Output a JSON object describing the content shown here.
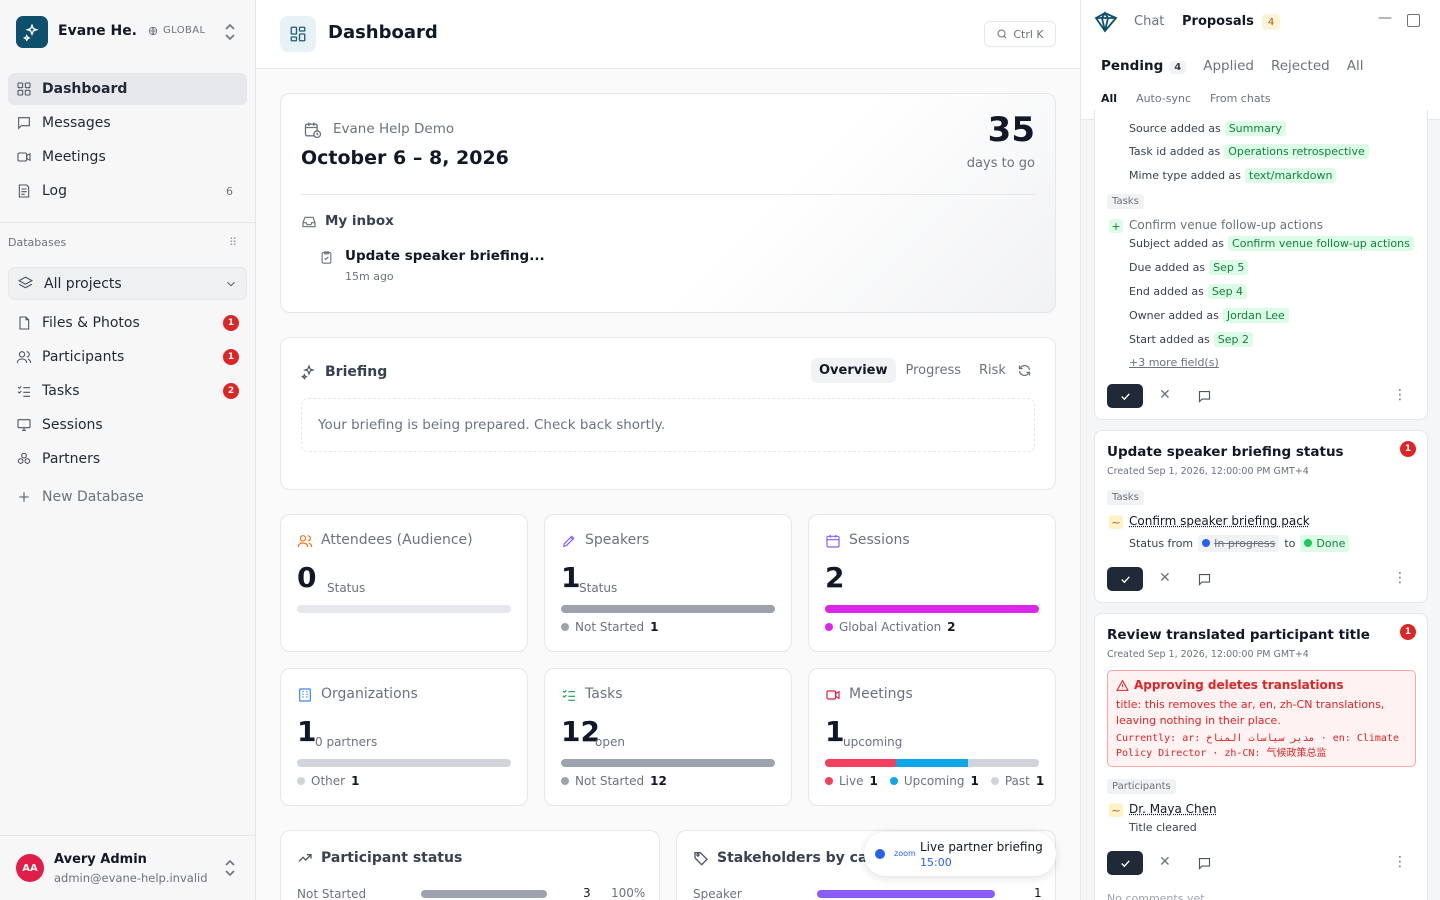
{
  "workspace": {
    "name": "Evane He...",
    "scope": "GLOBAL"
  },
  "nav": [
    {
      "label": "Dashboard",
      "active": true
    },
    {
      "label": "Messages"
    },
    {
      "label": "Meetings"
    },
    {
      "label": "Log",
      "count": "6"
    }
  ],
  "databases": {
    "label": "Databases",
    "selector": "All projects",
    "items": [
      {
        "label": "Files & Photos",
        "badge": "1"
      },
      {
        "label": "Participants",
        "badge": "1"
      },
      {
        "label": "Tasks",
        "badge": "2"
      },
      {
        "label": "Sessions"
      },
      {
        "label": "Partners"
      }
    ],
    "new_label": "New Database"
  },
  "user": {
    "initials": "AA",
    "name": "Avery Admin",
    "email": "admin@evane-help.invalid"
  },
  "header": {
    "title": "Dashboard",
    "search_shortcut": "Ctrl K"
  },
  "event": {
    "name": "Evane Help Demo",
    "dates": "October 6 – 8, 2026",
    "days": "35",
    "days_label": "days to go",
    "inbox_label": "My inbox",
    "inbox_item": "Update speaker briefing...",
    "inbox_time": "15m ago"
  },
  "briefing": {
    "title": "Briefing",
    "tabs": [
      "Overview",
      "Progress",
      "Risk"
    ],
    "message": "Your briefing is being prepared. Check back shortly."
  },
  "stats": [
    {
      "title": "Attendees (Audience)",
      "value": "0",
      "unit": "Status",
      "legend": []
    },
    {
      "title": "Speakers",
      "value": "1",
      "unit": "Status",
      "legend": [
        {
          "label": "Not Started",
          "count": "1",
          "color": "#9ca3af"
        }
      ]
    },
    {
      "title": "Sessions",
      "value": "2",
      "unit": "",
      "legend": [
        {
          "label": "Global Activation",
          "count": "2",
          "color": "#d926e9"
        }
      ]
    },
    {
      "title": "Organizations",
      "value": "1",
      "unit": "0 partners",
      "legend": [
        {
          "label": "Other",
          "count": "1",
          "color": "#d1d5db"
        }
      ]
    },
    {
      "title": "Tasks",
      "value": "12",
      "unit": "open",
      "legend": [
        {
          "label": "Not Started",
          "count": "12",
          "color": "#9ca3af"
        }
      ]
    },
    {
      "title": "Meetings",
      "value": "1",
      "unit": "upcoming",
      "legend": [
        {
          "label": "Live",
          "count": "1",
          "color": "#f43f5e"
        },
        {
          "label": "Upcoming",
          "count": "1",
          "color": "#0ea5e9"
        },
        {
          "label": "Past",
          "count": "1",
          "color": "#d1d5db"
        }
      ]
    }
  ],
  "participant_status": {
    "title": "Participant status",
    "row_label": "Not Started",
    "row_value": "3",
    "row_pct": "100%"
  },
  "stakeholders": {
    "title": "Stakeholders by categ",
    "row_label": "Speaker",
    "row_value": "1"
  },
  "toast": {
    "brand": "zoom",
    "title": "Live partner briefing",
    "time": "15:00"
  },
  "panel": {
    "tabs": {
      "chat": "Chat",
      "proposals": "Proposals",
      "proposals_count": "4"
    },
    "status_tabs": [
      {
        "label": "Pending",
        "count": "4"
      },
      {
        "label": "Applied"
      },
      {
        "label": "Rejected"
      },
      {
        "label": "All"
      }
    ],
    "sub_tabs": [
      "All",
      "Auto-sync",
      "From chats"
    ],
    "card1": {
      "fields_top": [
        {
          "label": "Source added as",
          "value": "Summary"
        },
        {
          "label": "Task id added as",
          "value": "Operations retrospective"
        },
        {
          "label": "Mime type added as",
          "value": "text/markdown"
        }
      ],
      "tag": "Tasks",
      "item": "Confirm venue follow-up actions",
      "fields": [
        {
          "label": "Subject added as",
          "value": "Confirm venue follow-up actions"
        },
        {
          "label": "Due added as",
          "value": "Sep 5"
        },
        {
          "label": "End added as",
          "value": "Sep 4"
        },
        {
          "label": "Owner added as",
          "value": "Jordan Lee"
        },
        {
          "label": "Start added as",
          "value": "Sep 2"
        }
      ],
      "more": "+3 more field(s)"
    },
    "card2": {
      "title": "Update speaker briefing status",
      "date": "Created Sep 1, 2026, 12:00:00 PM GMT+4",
      "badge": "1",
      "tag": "Tasks",
      "item": "Confirm speaker briefing pack",
      "status_label": "Status from",
      "from": "In progress",
      "to_label": "to",
      "to": "Done"
    },
    "card3": {
      "title": "Review translated participant title",
      "date": "Created Sep 1, 2026, 12:00:00 PM GMT+4",
      "badge": "1",
      "warn_title": "Approving deletes translations",
      "warn_body": "title: this removes the ar, en, zh-CN translations, leaving nothing in their place.",
      "warn_current": "Currently: ar: مدير سياسات المناخ · en: Climate Policy Director · zh-CN: 气候政策总监",
      "tag": "Participants",
      "item": "Dr. Maya Chen",
      "change": "Title cleared",
      "comments": "No comments yet"
    }
  }
}
